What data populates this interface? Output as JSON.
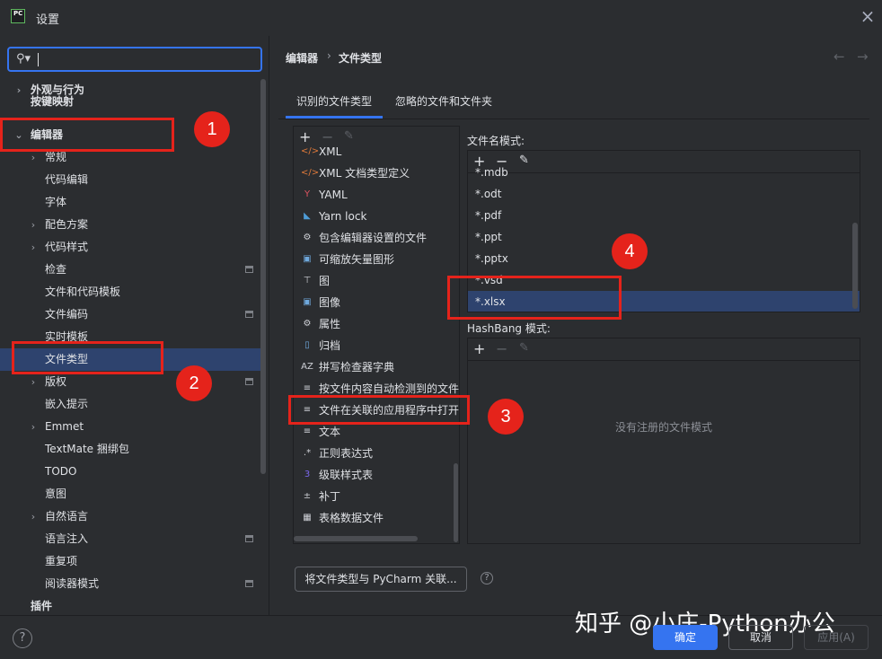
{
  "window": {
    "title": "设置",
    "logo": "PC"
  },
  "search": {
    "value": ""
  },
  "tree": [
    {
      "label": "外观与行为",
      "depth": 0,
      "chevron": "›",
      "bold": true
    },
    {
      "label": "按键映射",
      "depth": 0,
      "chevron": "",
      "bold": true,
      "partial": true
    },
    {
      "label": "编辑器",
      "depth": 0,
      "chevron": "⌄",
      "bold": true
    },
    {
      "label": "常规",
      "depth": 1,
      "chevron": "›"
    },
    {
      "label": "代码编辑",
      "depth": 1,
      "chevron": ""
    },
    {
      "label": "字体",
      "depth": 1,
      "chevron": ""
    },
    {
      "label": "配色方案",
      "depth": 1,
      "chevron": "›"
    },
    {
      "label": "代码样式",
      "depth": 1,
      "chevron": "›"
    },
    {
      "label": "检查",
      "depth": 1,
      "chevron": "",
      "pin": true
    },
    {
      "label": "文件和代码模板",
      "depth": 1,
      "chevron": ""
    },
    {
      "label": "文件编码",
      "depth": 1,
      "chevron": "",
      "pin": true
    },
    {
      "label": "实时模板",
      "depth": 1,
      "chevron": ""
    },
    {
      "label": "文件类型",
      "depth": 1,
      "chevron": "",
      "selected": true
    },
    {
      "label": "版权",
      "depth": 1,
      "chevron": "›",
      "pin": true
    },
    {
      "label": "嵌入提示",
      "depth": 1,
      "chevron": ""
    },
    {
      "label": "Emmet",
      "depth": 1,
      "chevron": "›"
    },
    {
      "label": "TextMate 捆绑包",
      "depth": 1,
      "chevron": ""
    },
    {
      "label": "TODO",
      "depth": 1,
      "chevron": ""
    },
    {
      "label": "意图",
      "depth": 1,
      "chevron": ""
    },
    {
      "label": "自然语言",
      "depth": 1,
      "chevron": "›"
    },
    {
      "label": "语言注入",
      "depth": 1,
      "chevron": "",
      "pin": true
    },
    {
      "label": "重复项",
      "depth": 1,
      "chevron": ""
    },
    {
      "label": "阅读器模式",
      "depth": 1,
      "chevron": "",
      "pin": true
    },
    {
      "label": "插件",
      "depth": 0,
      "chevron": "",
      "bold": true
    }
  ],
  "breadcrumb": {
    "parent": "编辑器",
    "separator": "›",
    "current": "文件类型"
  },
  "nav": {
    "back": "←",
    "forward": "→"
  },
  "tabs": [
    {
      "label": "识别的文件类型",
      "active": true
    },
    {
      "label": "忽略的文件和文件夹",
      "active": false
    }
  ],
  "toolbar": {
    "add": "+",
    "remove": "−",
    "edit": "✎"
  },
  "file_types": [
    {
      "label": "XML",
      "icon": "code-icon",
      "glyph": "</>",
      "color": "#e07a3a"
    },
    {
      "label": "XML 文档类型定义",
      "icon": "code-icon",
      "glyph": "</>",
      "color": "#e07a3a"
    },
    {
      "label": "YAML",
      "icon": "yaml-icon",
      "glyph": "Y",
      "color": "#e05561"
    },
    {
      "label": "Yarn lock",
      "icon": "yarn-icon",
      "glyph": "◣",
      "color": "#4e9bd6"
    },
    {
      "label": "包含编辑器设置的文件",
      "icon": "gear-icon",
      "glyph": "⚙",
      "color": "#cfd1d7"
    },
    {
      "label": "可缩放矢量图形",
      "icon": "image-icon",
      "glyph": "▣",
      "color": "#6fa8dc"
    },
    {
      "label": "图",
      "icon": "diagram-icon",
      "glyph": "⊤",
      "color": "#cfd1d7"
    },
    {
      "label": "图像",
      "icon": "image-icon",
      "glyph": "▣",
      "color": "#6fa8dc"
    },
    {
      "label": "属性",
      "icon": "gear-icon",
      "glyph": "⚙",
      "color": "#cfd1d7"
    },
    {
      "label": "归档",
      "icon": "archive-icon",
      "glyph": "▯",
      "color": "#6fa8dc"
    },
    {
      "label": "拼写检查器字典",
      "icon": "dictionary-icon",
      "glyph": "AZ",
      "color": "#cfd1d7"
    },
    {
      "label": "按文件内容自动检测到的文件",
      "icon": "text-icon",
      "glyph": "≡",
      "color": "#cfd1d7"
    },
    {
      "label": "文件在关联的应用程序中打开",
      "icon": "text-icon",
      "glyph": "≡",
      "color": "#cfd1d7"
    },
    {
      "label": "文本",
      "icon": "text-icon",
      "glyph": "≡",
      "color": "#cfd1d7"
    },
    {
      "label": "正则表达式",
      "icon": "regex-icon",
      "glyph": ".*",
      "color": "#cfd1d7"
    },
    {
      "label": "级联样式表",
      "icon": "css-icon",
      "glyph": "3",
      "color": "#7b68ee"
    },
    {
      "label": "补丁",
      "icon": "patch-icon",
      "glyph": "±",
      "color": "#cfd1d7"
    },
    {
      "label": "表格数据文件",
      "icon": "table-icon",
      "glyph": "▦",
      "color": "#cfd1d7"
    }
  ],
  "patterns": {
    "label": "文件名模式:",
    "items": [
      {
        "value": "*.mdb",
        "partial": true
      },
      {
        "value": "*.odt"
      },
      {
        "value": "*.pdf"
      },
      {
        "value": "*.ppt"
      },
      {
        "value": "*.pptx"
      },
      {
        "value": "*.vsd"
      },
      {
        "value": "*.xlsx",
        "selected": true
      }
    ]
  },
  "hashbang": {
    "label": "HashBang 模式:",
    "empty": "没有注册的文件模式"
  },
  "associate_button": "将文件类型与 PyCharm 关联...",
  "help": "?",
  "footer": {
    "ok": "确定",
    "cancel": "取消",
    "apply": "应用(A)"
  },
  "watermark": "知乎 @小庄-Python办公",
  "annotations": [
    "1",
    "2",
    "3",
    "4"
  ],
  "colors": {
    "accent": "#3574f0",
    "selection": "#2e436e",
    "annotation": "#e5231b",
    "background": "#2b2d30"
  }
}
